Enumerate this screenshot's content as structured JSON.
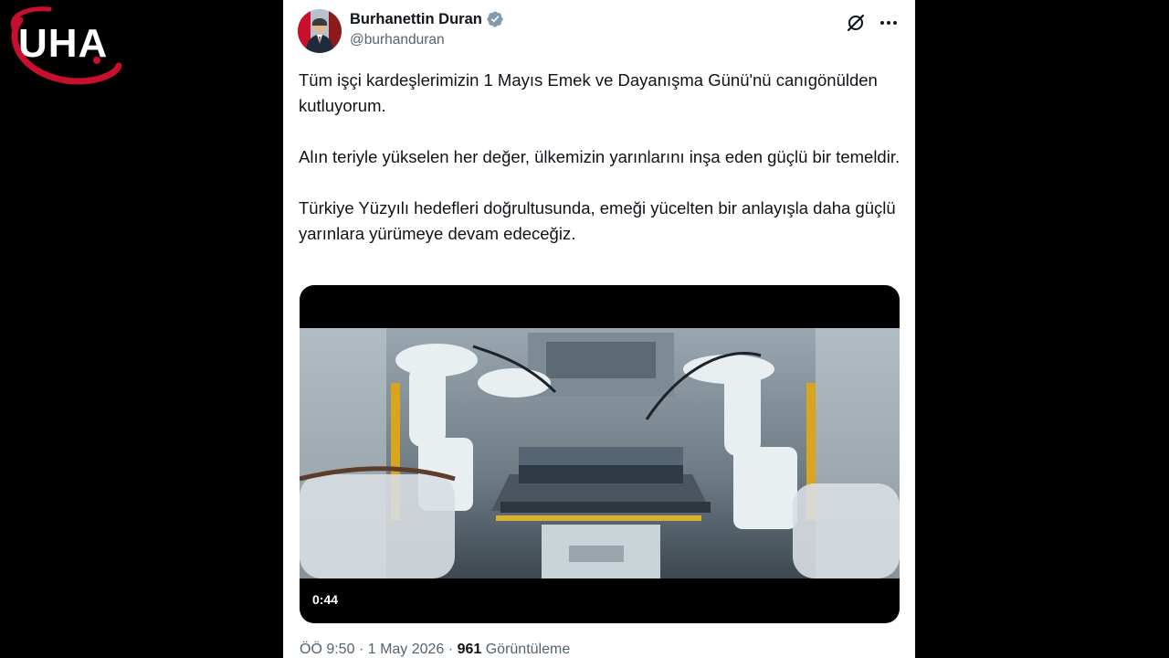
{
  "watermark": {
    "logo_text": "UHA"
  },
  "tweet": {
    "author": {
      "display_name": "Burhanettin Duran",
      "handle": "@burhanduran",
      "verified": true
    },
    "paragraphs": [
      "Tüm işçi kardeşlerimizin 1 Mayıs Emek ve Dayanışma Günü'nü canıgönülden kutluyorum.",
      "Alın teriyle yükselen her değer, ülkemizin yarınlarını inşa eden güçlü bir temeldir.",
      "Türkiye Yüzyılı hedefleri doğrultusunda, emeği yücelten bir anlayışla daha güçlü yarınlara yürümeye devam edeceğiz."
    ],
    "media": {
      "type": "video",
      "duration": "0:44"
    },
    "time": "ÖÖ 9:50",
    "separator": "·",
    "date": "1 May 2026",
    "views_count": "961",
    "views_label": "Görüntüleme"
  },
  "icons": {
    "verified": "verified-badge-icon",
    "grok": "grok-icon",
    "more": "more-icon"
  },
  "colors": {
    "background": "#000000",
    "card": "#ffffff",
    "text_primary": "#0f1419",
    "text_secondary": "#536471",
    "verified_badge": "#829aab",
    "logo_red": "#c8102e"
  }
}
